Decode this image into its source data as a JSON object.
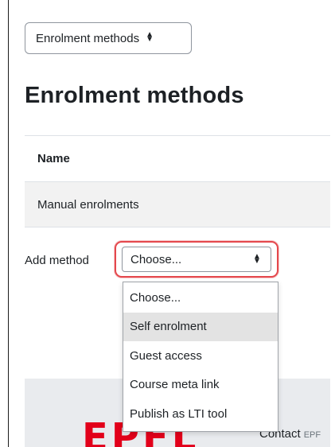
{
  "nav": {
    "select_label": "Enrolment methods"
  },
  "page": {
    "title": "Enrolment methods"
  },
  "table": {
    "header_name": "Name",
    "rows": [
      {
        "name": "Manual enrolments"
      }
    ]
  },
  "add_method": {
    "label": "Add method",
    "current_value": "Choose...",
    "options": [
      "Choose...",
      "Self enrolment",
      "Guest access",
      "Course meta link",
      "Publish as LTI tool"
    ],
    "highlighted_option": "Self enrolment"
  },
  "footer": {
    "logo_text": "EPFL",
    "contact_label": "Contact",
    "contact_trail": "EPF"
  },
  "colors": {
    "focus_ring": "#e4484d",
    "logo_red": "#e2001a",
    "row_background": "#f2f2f2",
    "footer_background": "#e9ebee"
  }
}
